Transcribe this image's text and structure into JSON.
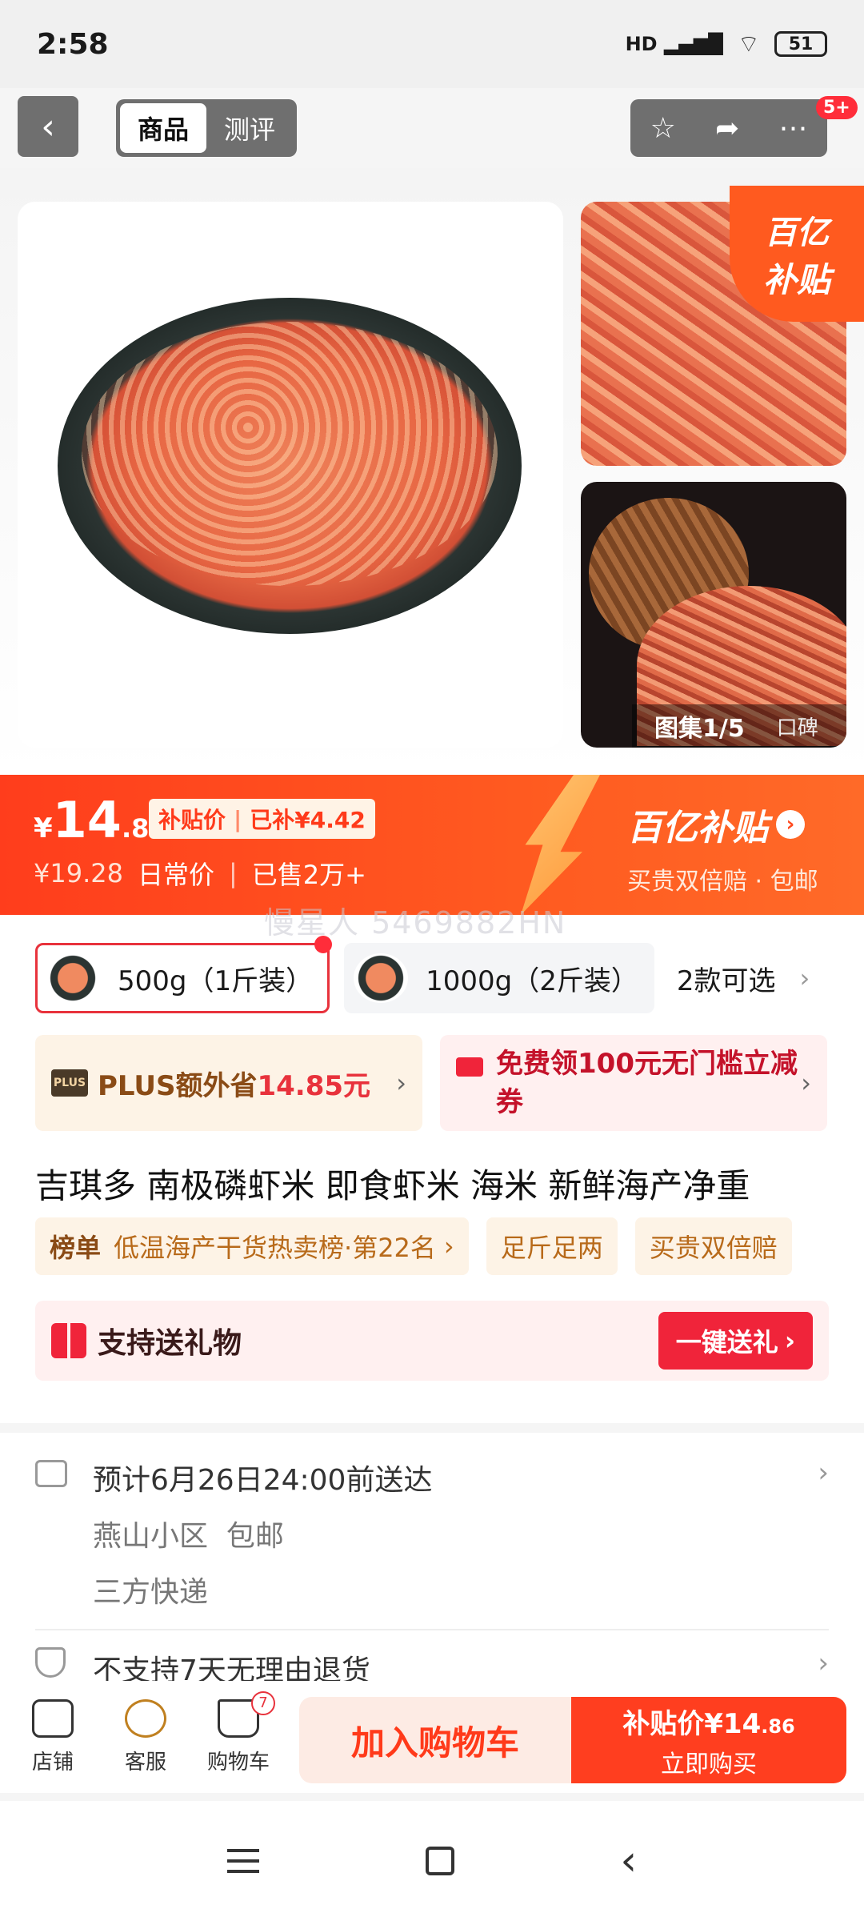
{
  "status": {
    "time": "2:58",
    "hd": "HD",
    "battery": "51"
  },
  "nav": {
    "back_icon": "back-arrow-icon",
    "tabs": [
      {
        "label": "商品"
      },
      {
        "label": "测评"
      }
    ],
    "notif_count": "5+"
  },
  "gallery": {
    "counter": "图集1/5",
    "reviews_label": "口碑",
    "subsidy_badge_line1": "百亿",
    "subsidy_badge_line2": "补贴"
  },
  "price": {
    "currency": "¥",
    "integer": "14",
    "decimal": ".86",
    "subsidy_label": "补贴价",
    "subsidy_amount": "已补¥4.42",
    "original": "¥19.28",
    "original_label": "日常价",
    "sold": "已售2万+",
    "brand_title": "百亿补贴",
    "brand_sub": "买贵双倍赔 · 包邮"
  },
  "watermark": "慢星人 5469882HN",
  "variants": [
    {
      "label": "500g（1斤装）"
    },
    {
      "label": "1000g（2斤装）"
    }
  ],
  "variant_more": "2款可选",
  "promos": {
    "plus_logo": "PLUS",
    "plus_text": "PLUS额外省",
    "plus_amount": "14.85元",
    "coupon_text": "免费领100元无门槛立减券"
  },
  "title": "吉琪多 南极磷虾米 即食虾米 海米 新鲜海产净重",
  "tags": {
    "rank_label": "榜单",
    "rank_text": "低温海产干货热卖榜·第22名",
    "tag2": "足斤足两",
    "tag3": "买贵双倍赔"
  },
  "gift": {
    "text": "支持送礼物",
    "button": "一键送礼"
  },
  "delivery": {
    "eta": "预计6月26日24:00前送达",
    "address": "燕山小区",
    "shipping": "包邮",
    "courier": "三方快递",
    "return_policy": "不支持7天无理由退货"
  },
  "actionbar": {
    "shop": "店铺",
    "service": "客服",
    "cart": "购物车",
    "cart_count": "7",
    "add_cart": "加入购物车",
    "buy_price_label": "补贴价¥14",
    "buy_price_dec": ".86",
    "buy_now": "立即购买"
  }
}
